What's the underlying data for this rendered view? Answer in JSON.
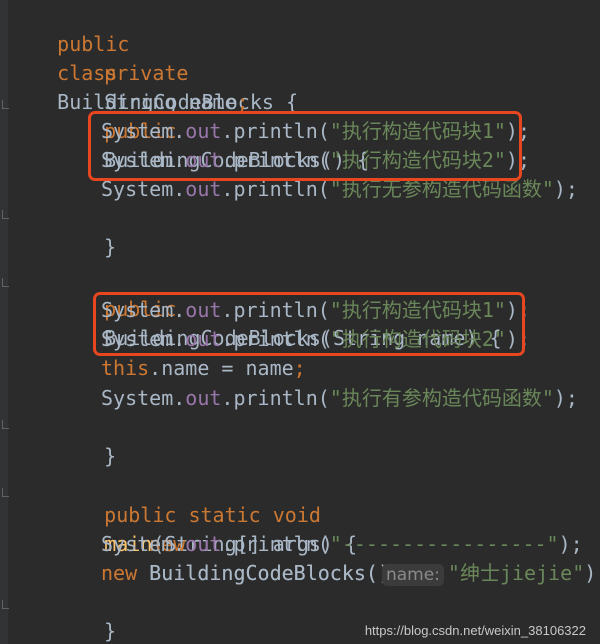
{
  "editor": {
    "lines": {
      "l1": {
        "a": "public",
        "b": "class",
        "c": "BuildingCodeBlocks {"
      },
      "l2": {
        "a": "private",
        "b": "String name",
        "c": ";"
      },
      "l3": {
        "a": "public",
        "b": "BuildingCodeBlocks() {"
      },
      "l4": {
        "a": "System.",
        "b": "out",
        "c": ".println(",
        "d": "\"执行构造代码块1\"",
        "e": ");"
      },
      "l5": {
        "a": "System.",
        "b": "out",
        "c": ".println(",
        "d": "\"执行构造代码块2\"",
        "e": ");"
      },
      "l6": {
        "a": "System.",
        "b": "out",
        "c": ".println(",
        "d": "\"执行无参构造代码函数\"",
        "e": ");"
      },
      "l7": {
        "a": "}"
      },
      "l8": {
        "a": "public",
        "b": "BuildingCodeBlocks(String name) {"
      },
      "l9": {
        "a": "System.",
        "b": "out",
        "c": ".println(",
        "d": "\"执行构造代码块1\"",
        "e": ");"
      },
      "l10": {
        "a": "System.",
        "b": "out",
        "c": ".println(",
        "d": "\"执行构造代码块2\"",
        "e": ");"
      },
      "l11": {
        "a": "this",
        "b": ".name = name",
        "c": ";"
      },
      "l12": {
        "a": "System.",
        "b": "out",
        "c": ".println(",
        "d": "\"执行有参构造代码函数\"",
        "e": ");"
      },
      "l13": {
        "a": "}"
      },
      "l14": {
        "a": "public static void",
        "b": "main",
        "c": "(String[] args) {"
      },
      "l15": {
        "a": "new",
        "b": "BuildingCodeBlocks()",
        "c": ";"
      },
      "l16": {
        "a": "System.",
        "b": "out",
        "c": ".println(",
        "d": "\"-----------------\"",
        "e": ");"
      },
      "l17": {
        "a": "new",
        "b": "BuildingCodeBlocks(",
        "hint": "name:",
        "d": "\"绅士jiejie\"",
        "e": ");"
      },
      "l18": {
        "a": "}"
      },
      "l19": {
        "a": "}"
      }
    },
    "highlight_color": "#e8461f"
  },
  "watermark": "https://blog.csdn.net/weixin_38106322"
}
